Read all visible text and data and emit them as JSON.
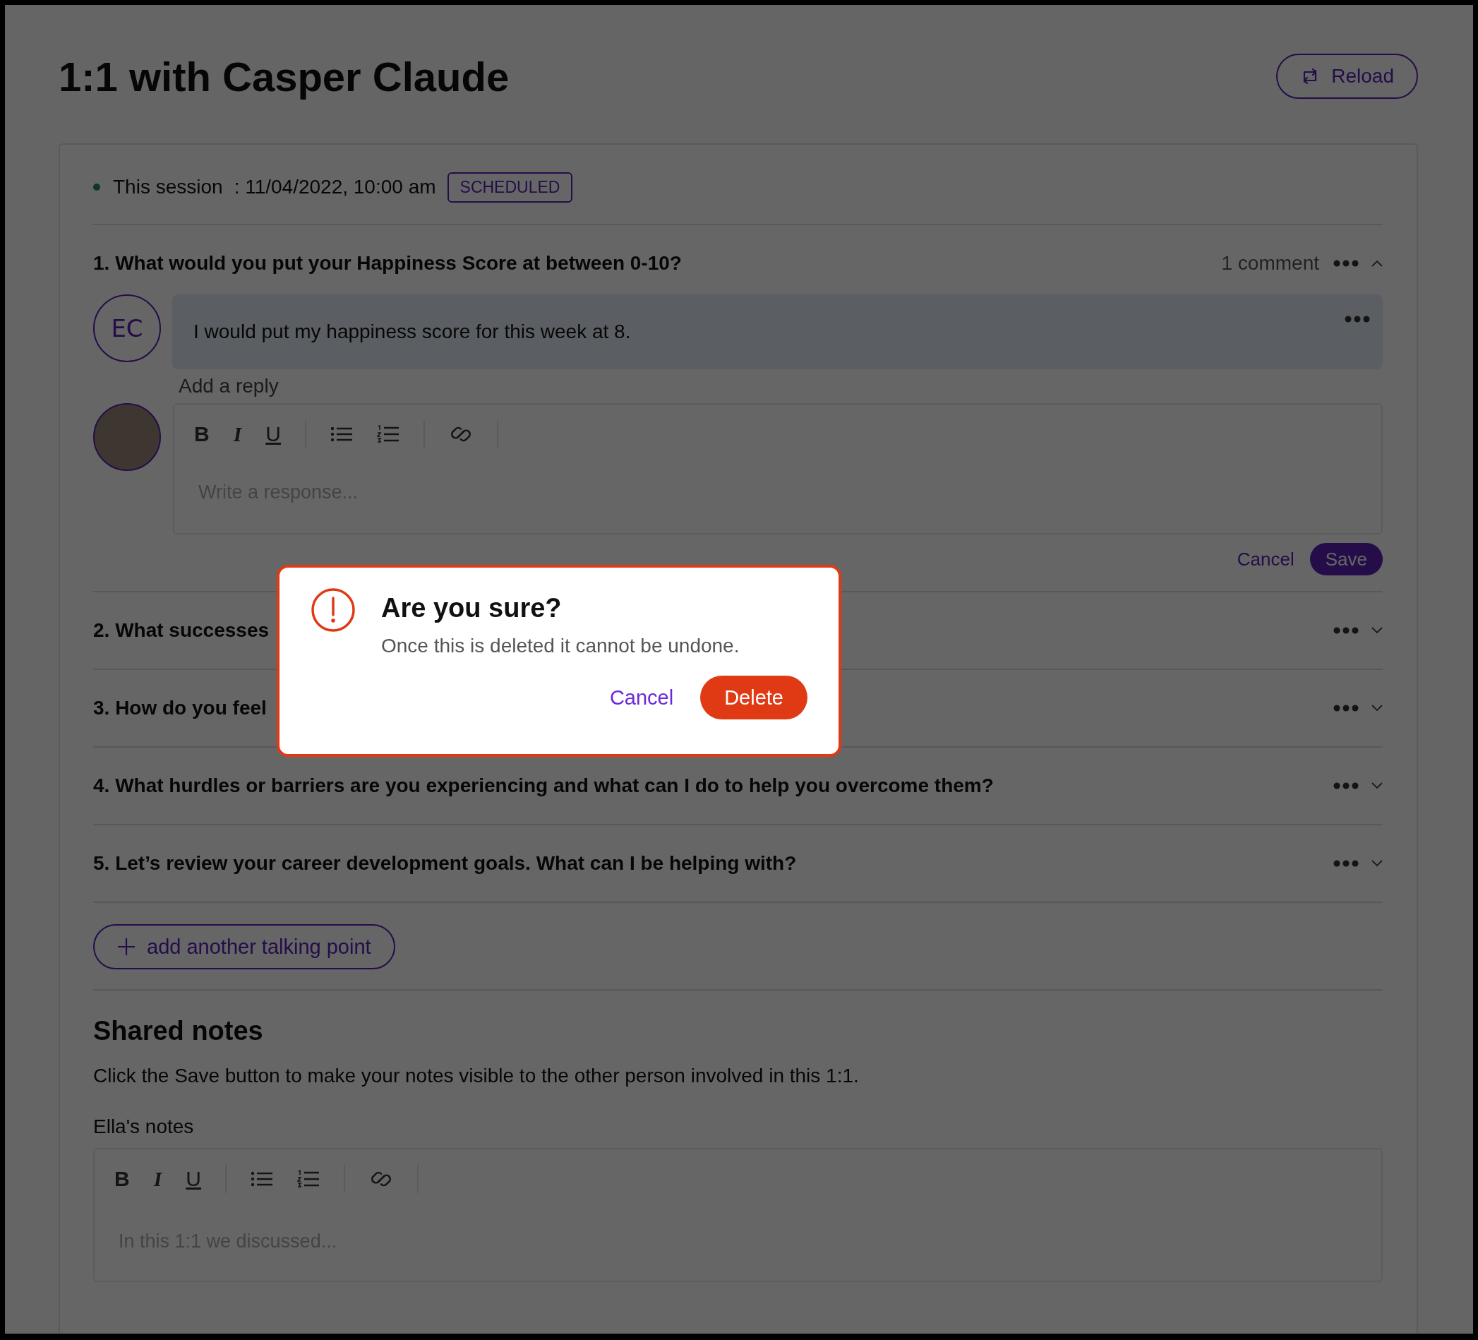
{
  "page": {
    "title": "1:1 with Casper Claude",
    "reload_button": "Reload"
  },
  "session": {
    "label": "This session",
    "date": ": 11/04/2022, 10:00 am",
    "status": "SCHEDULED"
  },
  "talking_points": [
    {
      "question": "1. What would you put your Happiness Score at between 0-10?",
      "comment_count": "1 comment",
      "expanded": true,
      "comments": [
        {
          "initials": "EC",
          "text": "I would put my happiness score for this week at 8."
        }
      ],
      "reply": {
        "label": "Add a reply",
        "placeholder": "Write a response...",
        "cancel": "Cancel",
        "save": "Save",
        "toolbar": [
          {
            "kind": "bold",
            "label": "B"
          },
          {
            "kind": "italic",
            "label": "I"
          },
          {
            "kind": "underline",
            "label": "U"
          },
          {
            "kind": "separator"
          },
          {
            "kind": "bullets"
          },
          {
            "kind": "numbered"
          },
          {
            "kind": "separator"
          },
          {
            "kind": "link"
          },
          {
            "kind": "separator"
          }
        ]
      }
    },
    {
      "question": "2. What successes",
      "expanded": false
    },
    {
      "question": "3. How do you feel",
      "expanded": false
    },
    {
      "question": "4. What hurdles or barriers are you experiencing and what can I do to help you overcome them?",
      "expanded": false
    },
    {
      "question": "5. Let’s review your career development goals. What can I be helping with?",
      "expanded": false
    }
  ],
  "add_talking_point": "add another talking point",
  "shared_notes": {
    "heading": "Shared notes",
    "description": "Click the Save button to make your notes visible to the other person involved in this 1:1.",
    "notes_label": "Ella's notes",
    "placeholder": "In this 1:1 we discussed...",
    "toolbar": [
      {
        "kind": "bold",
        "label": "B"
      },
      {
        "kind": "italic",
        "label": "I"
      },
      {
        "kind": "underline",
        "label": "U"
      },
      {
        "kind": "separator"
      },
      {
        "kind": "bullets"
      },
      {
        "kind": "numbered"
      },
      {
        "kind": "separator"
      },
      {
        "kind": "link"
      },
      {
        "kind": "separator"
      }
    ]
  },
  "dialog": {
    "title": "Are you sure?",
    "message": "Once this is deleted it cannot be undone.",
    "cancel": "Cancel",
    "confirm": "Delete"
  }
}
